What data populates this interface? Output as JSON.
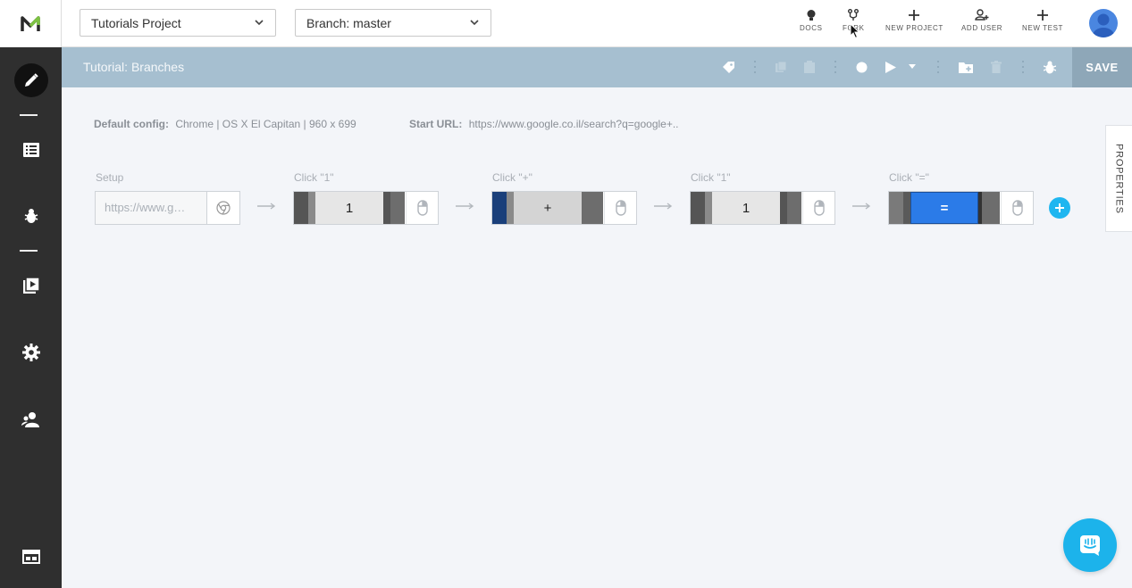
{
  "topbar": {
    "project_select": "Tutorials Project",
    "branch_select": "Branch: master",
    "actions": [
      {
        "label": "DOCS",
        "icon": "lightbulb-icon"
      },
      {
        "label": "FORK",
        "icon": "fork-icon"
      },
      {
        "label": "NEW PROJECT",
        "icon": "plus-icon"
      },
      {
        "label": "ADD USER",
        "icon": "add-user-icon"
      },
      {
        "label": "NEW TEST",
        "icon": "plus-icon"
      }
    ]
  },
  "sidebar": {
    "items": [
      {
        "icon": "pencil-icon"
      },
      {
        "icon": "list-icon"
      },
      {
        "icon": "bug-icon"
      },
      {
        "icon": "play-library-icon"
      },
      {
        "icon": "gear-icon"
      },
      {
        "icon": "users-icon"
      },
      {
        "icon": "panel-icon"
      }
    ]
  },
  "testbar": {
    "title": "Tutorial: Branches",
    "save_label": "SAVE"
  },
  "config": {
    "default_label": "Default config:",
    "default_value": "Chrome | OS X El Capitan | 960 x 699",
    "start_label": "Start URL:",
    "start_value": "https://www.google.co.il/search?q=google+.."
  },
  "steps": [
    {
      "label": "Setup",
      "value": "https://www.g…"
    },
    {
      "label": "Click \"1\"",
      "key": "1"
    },
    {
      "label": "Click \"+\"",
      "key": "+"
    },
    {
      "label": "Click \"1\"",
      "key": "1"
    },
    {
      "label": "Click \"=\"",
      "key": "="
    }
  ],
  "properties_label": "PROPERTIES",
  "colors": {
    "sidebar": "#2f2f2f",
    "testbar": "#a6bfd0",
    "accent": "#1fb6f0",
    "equals_key": "#2b7be8",
    "plus_key_edge": "#1a3f7a"
  }
}
